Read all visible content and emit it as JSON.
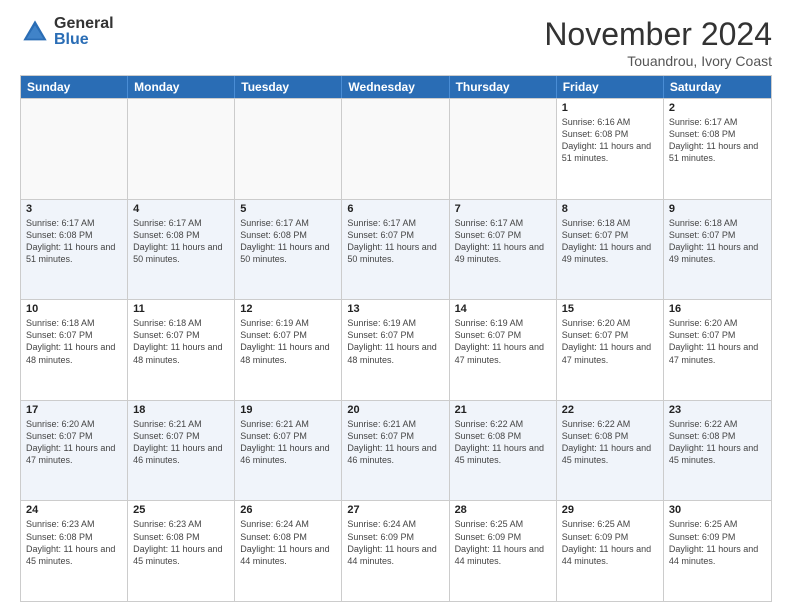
{
  "logo": {
    "general": "General",
    "blue": "Blue"
  },
  "title": "November 2024",
  "location": "Touandrou, Ivory Coast",
  "headers": [
    "Sunday",
    "Monday",
    "Tuesday",
    "Wednesday",
    "Thursday",
    "Friday",
    "Saturday"
  ],
  "weeks": [
    [
      {
        "day": "",
        "info": ""
      },
      {
        "day": "",
        "info": ""
      },
      {
        "day": "",
        "info": ""
      },
      {
        "day": "",
        "info": ""
      },
      {
        "day": "",
        "info": ""
      },
      {
        "day": "1",
        "info": "Sunrise: 6:16 AM\nSunset: 6:08 PM\nDaylight: 11 hours and 51 minutes."
      },
      {
        "day": "2",
        "info": "Sunrise: 6:17 AM\nSunset: 6:08 PM\nDaylight: 11 hours and 51 minutes."
      }
    ],
    [
      {
        "day": "3",
        "info": "Sunrise: 6:17 AM\nSunset: 6:08 PM\nDaylight: 11 hours and 51 minutes."
      },
      {
        "day": "4",
        "info": "Sunrise: 6:17 AM\nSunset: 6:08 PM\nDaylight: 11 hours and 50 minutes."
      },
      {
        "day": "5",
        "info": "Sunrise: 6:17 AM\nSunset: 6:08 PM\nDaylight: 11 hours and 50 minutes."
      },
      {
        "day": "6",
        "info": "Sunrise: 6:17 AM\nSunset: 6:07 PM\nDaylight: 11 hours and 50 minutes."
      },
      {
        "day": "7",
        "info": "Sunrise: 6:17 AM\nSunset: 6:07 PM\nDaylight: 11 hours and 49 minutes."
      },
      {
        "day": "8",
        "info": "Sunrise: 6:18 AM\nSunset: 6:07 PM\nDaylight: 11 hours and 49 minutes."
      },
      {
        "day": "9",
        "info": "Sunrise: 6:18 AM\nSunset: 6:07 PM\nDaylight: 11 hours and 49 minutes."
      }
    ],
    [
      {
        "day": "10",
        "info": "Sunrise: 6:18 AM\nSunset: 6:07 PM\nDaylight: 11 hours and 48 minutes."
      },
      {
        "day": "11",
        "info": "Sunrise: 6:18 AM\nSunset: 6:07 PM\nDaylight: 11 hours and 48 minutes."
      },
      {
        "day": "12",
        "info": "Sunrise: 6:19 AM\nSunset: 6:07 PM\nDaylight: 11 hours and 48 minutes."
      },
      {
        "day": "13",
        "info": "Sunrise: 6:19 AM\nSunset: 6:07 PM\nDaylight: 11 hours and 48 minutes."
      },
      {
        "day": "14",
        "info": "Sunrise: 6:19 AM\nSunset: 6:07 PM\nDaylight: 11 hours and 47 minutes."
      },
      {
        "day": "15",
        "info": "Sunrise: 6:20 AM\nSunset: 6:07 PM\nDaylight: 11 hours and 47 minutes."
      },
      {
        "day": "16",
        "info": "Sunrise: 6:20 AM\nSunset: 6:07 PM\nDaylight: 11 hours and 47 minutes."
      }
    ],
    [
      {
        "day": "17",
        "info": "Sunrise: 6:20 AM\nSunset: 6:07 PM\nDaylight: 11 hours and 47 minutes."
      },
      {
        "day": "18",
        "info": "Sunrise: 6:21 AM\nSunset: 6:07 PM\nDaylight: 11 hours and 46 minutes."
      },
      {
        "day": "19",
        "info": "Sunrise: 6:21 AM\nSunset: 6:07 PM\nDaylight: 11 hours and 46 minutes."
      },
      {
        "day": "20",
        "info": "Sunrise: 6:21 AM\nSunset: 6:07 PM\nDaylight: 11 hours and 46 minutes."
      },
      {
        "day": "21",
        "info": "Sunrise: 6:22 AM\nSunset: 6:08 PM\nDaylight: 11 hours and 45 minutes."
      },
      {
        "day": "22",
        "info": "Sunrise: 6:22 AM\nSunset: 6:08 PM\nDaylight: 11 hours and 45 minutes."
      },
      {
        "day": "23",
        "info": "Sunrise: 6:22 AM\nSunset: 6:08 PM\nDaylight: 11 hours and 45 minutes."
      }
    ],
    [
      {
        "day": "24",
        "info": "Sunrise: 6:23 AM\nSunset: 6:08 PM\nDaylight: 11 hours and 45 minutes."
      },
      {
        "day": "25",
        "info": "Sunrise: 6:23 AM\nSunset: 6:08 PM\nDaylight: 11 hours and 45 minutes."
      },
      {
        "day": "26",
        "info": "Sunrise: 6:24 AM\nSunset: 6:08 PM\nDaylight: 11 hours and 44 minutes."
      },
      {
        "day": "27",
        "info": "Sunrise: 6:24 AM\nSunset: 6:09 PM\nDaylight: 11 hours and 44 minutes."
      },
      {
        "day": "28",
        "info": "Sunrise: 6:25 AM\nSunset: 6:09 PM\nDaylight: 11 hours and 44 minutes."
      },
      {
        "day": "29",
        "info": "Sunrise: 6:25 AM\nSunset: 6:09 PM\nDaylight: 11 hours and 44 minutes."
      },
      {
        "day": "30",
        "info": "Sunrise: 6:25 AM\nSunset: 6:09 PM\nDaylight: 11 hours and 44 minutes."
      }
    ]
  ]
}
